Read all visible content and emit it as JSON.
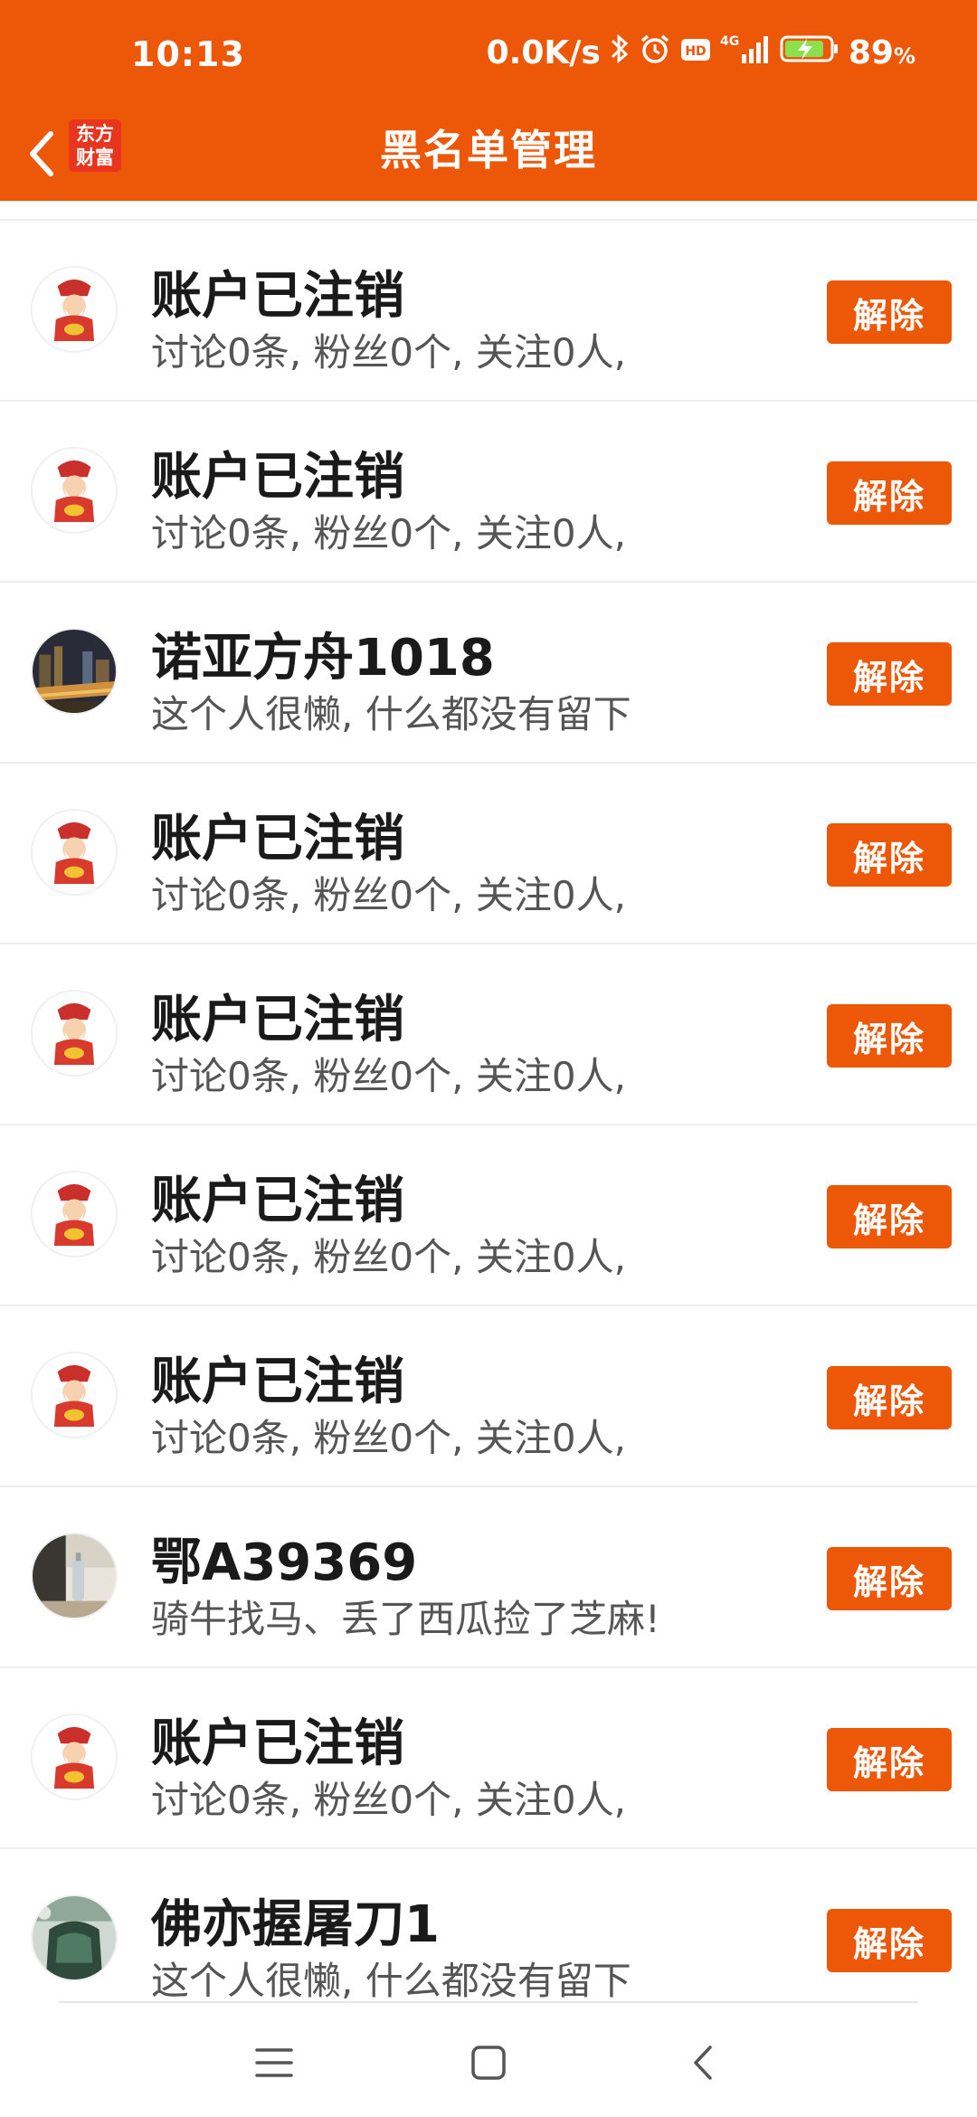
{
  "status_bar": {
    "time": "10:13",
    "net_speed": "0.0K/s",
    "network": "4G",
    "hd_badge": "HD",
    "battery": "89",
    "battery_unit": "%",
    "icons": [
      "bluetooth-icon",
      "alarm-icon",
      "hd-icon",
      "signal-icon",
      "battery-charging-icon"
    ]
  },
  "header": {
    "title": "黑名单管理",
    "logo_line1": "东方",
    "logo_line2": "财富",
    "accent_color": "#EC5708"
  },
  "blacklist": {
    "remove_label": "解除",
    "items": [
      {
        "name": "账户已注销",
        "desc": "讨论0条, 粉丝0个, 关注0人,",
        "avatar": "fortune-god-avatar"
      },
      {
        "name": "账户已注销",
        "desc": "讨论0条, 粉丝0个, 关注0人,",
        "avatar": "fortune-god-avatar"
      },
      {
        "name": "诺亚方舟1018",
        "desc": "这个人很懒, 什么都没有留下",
        "avatar": "city-night-photo-avatar"
      },
      {
        "name": "账户已注销",
        "desc": "讨论0条, 粉丝0个, 关注0人,",
        "avatar": "fortune-god-avatar"
      },
      {
        "name": "账户已注销",
        "desc": "讨论0条, 粉丝0个, 关注0人,",
        "avatar": "fortune-god-avatar"
      },
      {
        "name": "账户已注销",
        "desc": "讨论0条, 粉丝0个, 关注0人,",
        "avatar": "fortune-god-avatar"
      },
      {
        "name": "账户已注销",
        "desc": "讨论0条, 粉丝0个, 关注0人,",
        "avatar": "fortune-god-avatar"
      },
      {
        "name": "鄂A39369",
        "desc": "骑牛找马、丢了西瓜捡了芝麻!",
        "avatar": "photo-avatar"
      },
      {
        "name": "账户已注销",
        "desc": "讨论0条, 粉丝0个, 关注0人,",
        "avatar": "fortune-god-avatar"
      },
      {
        "name": "佛亦握屠刀1",
        "desc": "这个人很懒, 什么都没有留下",
        "avatar": "green-photo-avatar"
      }
    ]
  },
  "nav_bar": {
    "icons": [
      "menu-icon",
      "home-icon",
      "back-icon"
    ]
  }
}
